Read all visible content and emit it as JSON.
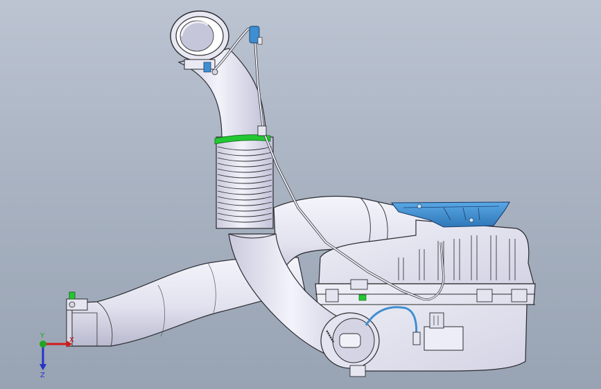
{
  "viewport": {
    "background_top": "#bcc4d2",
    "background_bottom": "#98a3b3"
  },
  "model": {
    "body_color": "#eeeef8",
    "shade_color": "#c9c9dd",
    "edge_color": "#2a2a2e",
    "accent_blue": "#3e8fd1",
    "accent_green": "#22c832"
  },
  "triad": {
    "x_label": "X",
    "y_label": "Y",
    "z_label": "Z",
    "x_color": "#d11a1a",
    "y_color": "#1fa51f",
    "z_color": "#2433c7"
  }
}
